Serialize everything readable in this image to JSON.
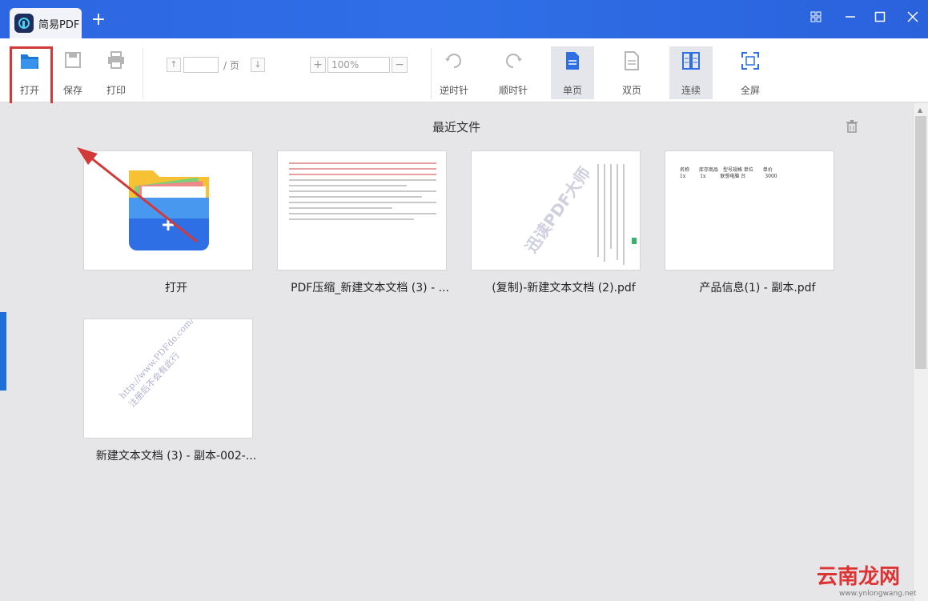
{
  "app": {
    "title": "简易PDF",
    "add_tab": "+"
  },
  "toolbar": {
    "open": "打开",
    "save": "保存",
    "print": "打印",
    "page_suffix": "/ 页",
    "page_value": "",
    "zoom_value": "100%",
    "zoom_minus": "−",
    "zoom_plus": "+",
    "rotate_ccw": "逆时针",
    "rotate_cw": "顺时针",
    "single_page": "单页",
    "double_page": "双页",
    "continuous": "连续",
    "fullscreen": "全屏"
  },
  "main": {
    "section_title": "最近文件",
    "files": [
      {
        "label": "打开"
      },
      {
        "label": "PDF压缩_新建文本文档 (3) - ..."
      },
      {
        "label": "(复制)-新建文本文档 (2).pdf"
      },
      {
        "label": "产品信息(1) - 副本.pdf"
      },
      {
        "label": "新建文本文档 (3) - 副本-002-..."
      }
    ],
    "thumb_watermarks": {
      "copy_pdf": "迅读PDF大师",
      "product_header": "名称　　库存商品　型号规格 单位　　单价",
      "product_row": "1x　　　1x　　　联想电脑 台　　　　3000",
      "trial": "http://www.PDFdo.com/ 试用版，注册后不会有此行"
    }
  },
  "watermark": {
    "brand": "云南龙网",
    "url": "www.ynlongwang.net"
  },
  "colors": {
    "accent": "#2d66e2",
    "highlight": "#d23a3a",
    "folder_blue": "#2f6fe6"
  }
}
